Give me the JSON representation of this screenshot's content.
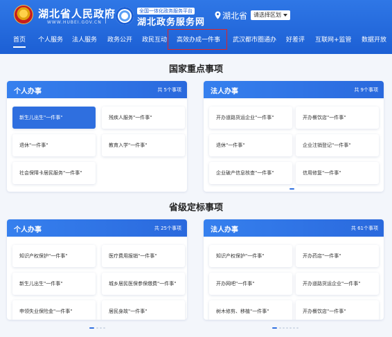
{
  "header": {
    "gov_name": "湖北省人民政府",
    "gov_url": "WWW.HUBEI.GOV.CN",
    "service_sub": "全国一体化政务服务平台",
    "service_name": "湖北政务服务网",
    "location": "湖北省",
    "region_button": "请选择区划",
    "brand_color": "#1c5fd4"
  },
  "nav": {
    "items": [
      {
        "label": "首页"
      },
      {
        "label": "个人服务"
      },
      {
        "label": "法人服务"
      },
      {
        "label": "政务公开"
      },
      {
        "label": "政民互动"
      },
      {
        "label": "高效办成一件事"
      },
      {
        "label": "武汉都市圈通办"
      },
      {
        "label": "好差评"
      },
      {
        "label": "互联网+监管"
      },
      {
        "label": "数据开放"
      }
    ],
    "active": "首页",
    "highlighted": "高效办成一件事"
  },
  "sections": [
    {
      "title": "国家重点事项",
      "panels": [
        {
          "title": "个人办事",
          "count": "共 5个事项",
          "cards": [
            "新生儿出生\"一件事\"",
            "残疾人服务\"一件事\"",
            "退休\"一件事\"",
            "教育入学\"一件事\"",
            "社会保障卡居民服务\"一件事\""
          ],
          "selected": 0
        },
        {
          "title": "法人办事",
          "count": "共 9个事项",
          "cards": [
            "开办道路货运企业\"一件事\"",
            "开办餐饮店\"一件事\"",
            "退休\"一件事\"",
            "企业注销登记\"一件事\"",
            "企业破产信息核查\"一件事\"",
            "信用修复\"一件事\""
          ]
        }
      ]
    },
    {
      "title": "省级定标事项",
      "panels": [
        {
          "title": "个人办事",
          "count": "共 25个事项",
          "cards": [
            "知识产权保护\"一件事\"",
            "医疗费用报销\"一件事\"",
            "新生儿出生\"一件事\"",
            "城乡居民医保参保缴费\"一件事\"",
            "申领失业保险金\"一件事\"",
            "居民身故\"一件事\""
          ]
        },
        {
          "title": "法人办事",
          "count": "共 61个事项",
          "cards": [
            "知识产权保护\"一件事\"",
            "开办药店\"一件事\"",
            "开办网吧\"一件事\"",
            "开办道路货运企业\"一件事\"",
            "树木修剪、移植\"一件事\"",
            "开办餐饮店\"一件事\""
          ]
        }
      ]
    }
  ]
}
